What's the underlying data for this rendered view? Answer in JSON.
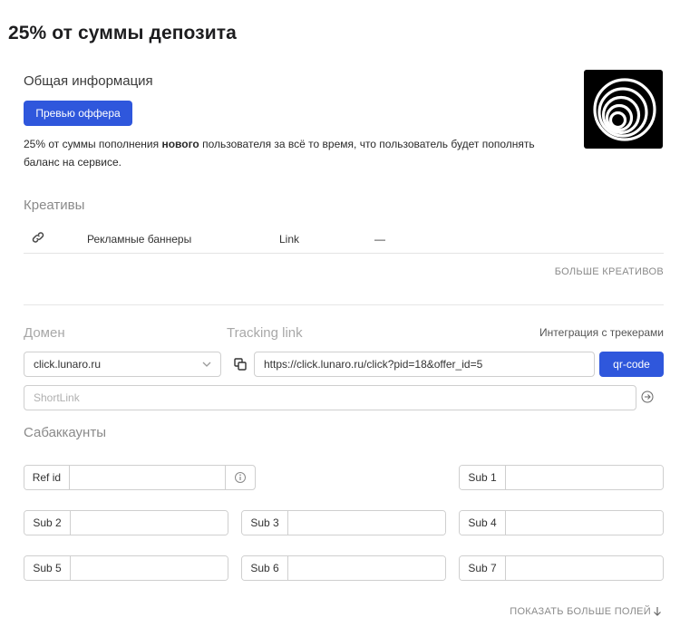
{
  "page": {
    "title": "25% от суммы депозита"
  },
  "general": {
    "heading": "Общая информация",
    "preview_button": "Превью оффера",
    "description_before": "25% от суммы пополнения ",
    "description_bold": "нового",
    "description_after": " пользователя за всё то время, что пользователь будет пополнять баланс на сервисе."
  },
  "creatives": {
    "heading": "Креативы",
    "rows": [
      {
        "icon": "link-icon",
        "name": "Рекламные баннеры",
        "type": "Link",
        "value": "—"
      }
    ],
    "more_label": "БОЛЬШЕ КРЕАТИВОВ"
  },
  "tracking": {
    "domain_label": "Домен",
    "link_label": "Tracking link",
    "integration_label": "Интеграция с трекерами",
    "domain_value": "click.lunaro.ru",
    "link_value": "https://click.lunaro.ru/click?pid=18&offer_id=5",
    "qr_button": "qr-code",
    "shortlink_placeholder": "ShortLink"
  },
  "subaccounts": {
    "heading": "Сабаккаунты",
    "ref_label": "Ref id",
    "labels": [
      "Sub 1",
      "Sub 2",
      "Sub 3",
      "Sub 4",
      "Sub 5",
      "Sub 6",
      "Sub 7"
    ],
    "show_more": "ПОКАЗАТЬ БОЛЬШЕ ПОЛЕЙ"
  },
  "colors": {
    "accent": "#2f57dc",
    "muted": "#8a8a8a",
    "border": "#cfcfcf"
  }
}
